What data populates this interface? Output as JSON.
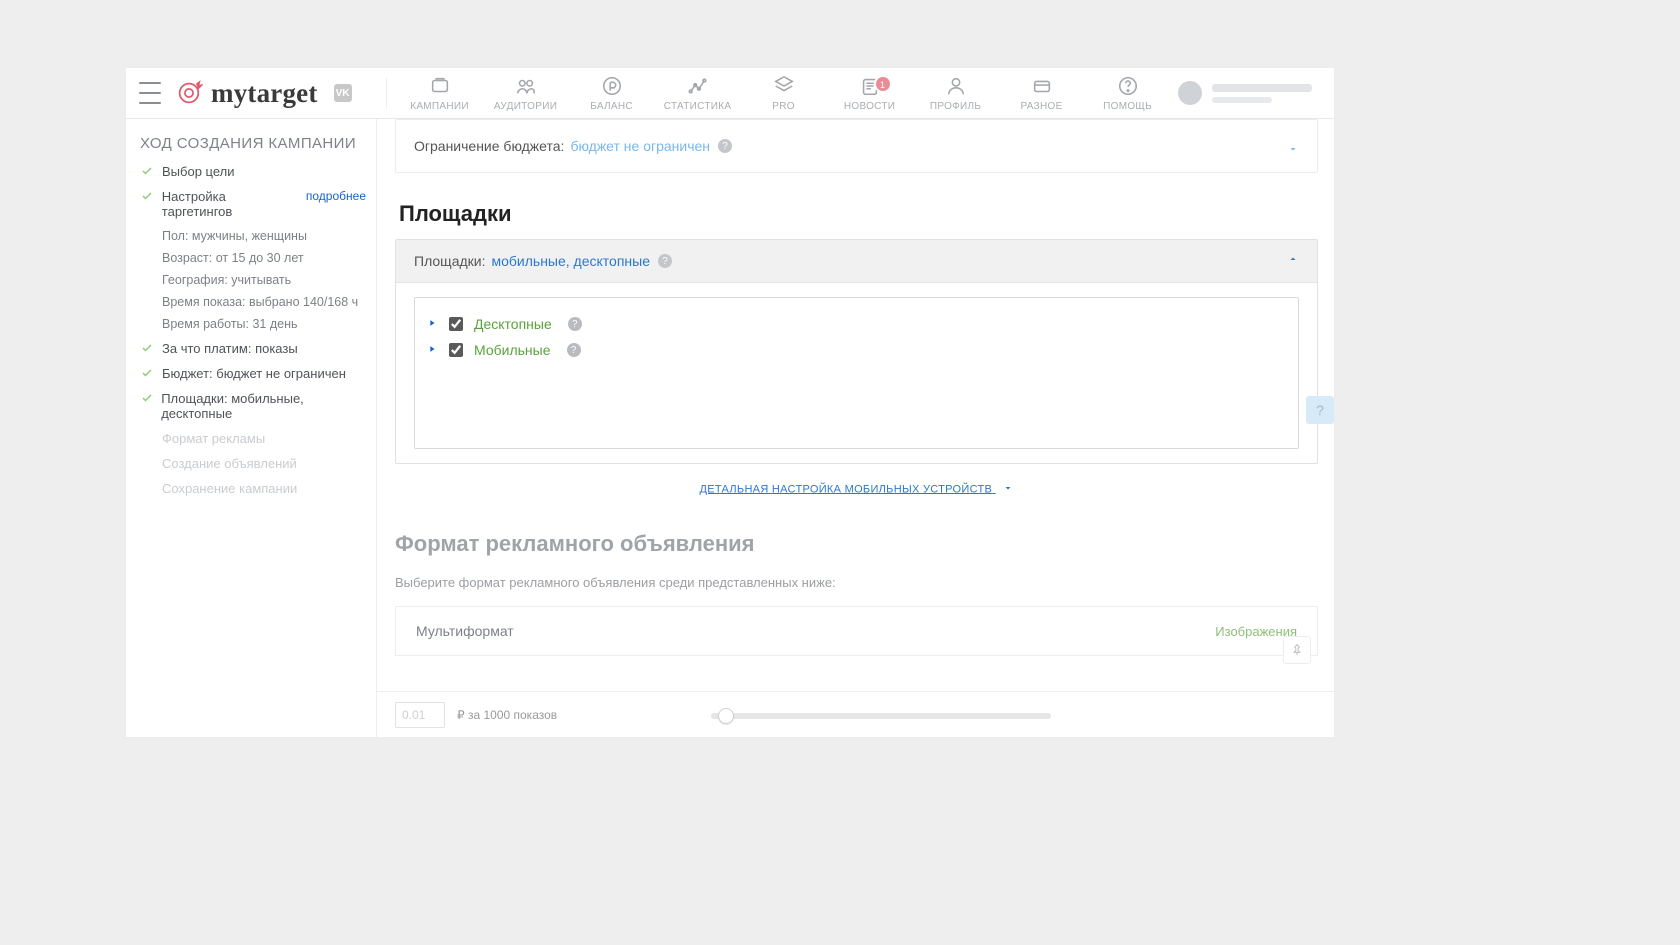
{
  "brand": {
    "name": "mytarget",
    "vk_badge": "VK"
  },
  "nav": [
    {
      "id": "campaigns",
      "label": "КАМПАНИИ"
    },
    {
      "id": "audiences",
      "label": "АУДИТОРИИ"
    },
    {
      "id": "balance",
      "label": "БАЛАНС"
    },
    {
      "id": "stats",
      "label": "СТАТИСТИКА"
    },
    {
      "id": "pro",
      "label": "PRO"
    },
    {
      "id": "news",
      "label": "НОВОСТИ",
      "badge": "1"
    },
    {
      "id": "profile",
      "label": "ПРОФИЛЬ"
    },
    {
      "id": "misc",
      "label": "РАЗНОЕ"
    },
    {
      "id": "help",
      "label": "ПОМОЩЬ"
    }
  ],
  "side": {
    "title": "ХОД СОЗДАНИЯ КАМПАНИИ",
    "steps": {
      "goal": "Выбор цели",
      "targeting": {
        "label": "Настройка таргетингов",
        "more": "подробнее"
      },
      "sub": {
        "gender": "Пол: мужчины, женщины",
        "age": "Возраст: от 15 до 30 лет",
        "geo": "География: учитывать",
        "time": "Время показа: выбрано 140/168 ч",
        "duration": "Время работы: 31 день"
      },
      "pay": "За что платим: показы",
      "budget": "Бюджет: бюджет не ограничен",
      "placements": "Площадки: мобильные, десктопные",
      "format": "Формат рекламы",
      "create": "Создание объявлений",
      "save": "Сохранение кампании"
    }
  },
  "budget": {
    "label": "Ограничение бюджета:",
    "value": "бюджет не ограничен"
  },
  "placements": {
    "title": "Площадки",
    "head_label": "Площадки:",
    "head_value": "мобильные, десктопные",
    "items": [
      {
        "id": "desktop",
        "label": "Десктопные",
        "checked": true
      },
      {
        "id": "mobile",
        "label": "Мобильные",
        "checked": true
      }
    ],
    "detail_link": "ДЕТАЛЬНАЯ НАСТРОЙКА МОБИЛЬНЫХ УСТРОЙСТВ"
  },
  "ad": {
    "title": "Формат рекламного объявления",
    "sub": "Выберите формат рекламного объявления среди представленных ниже:",
    "format_name": "Мультиформат",
    "format_tag": "Изображения"
  },
  "price": {
    "value": "0.01",
    "label": "₽ за 1000 показов"
  },
  "helpers": {
    "q": "?",
    "pin": ""
  }
}
